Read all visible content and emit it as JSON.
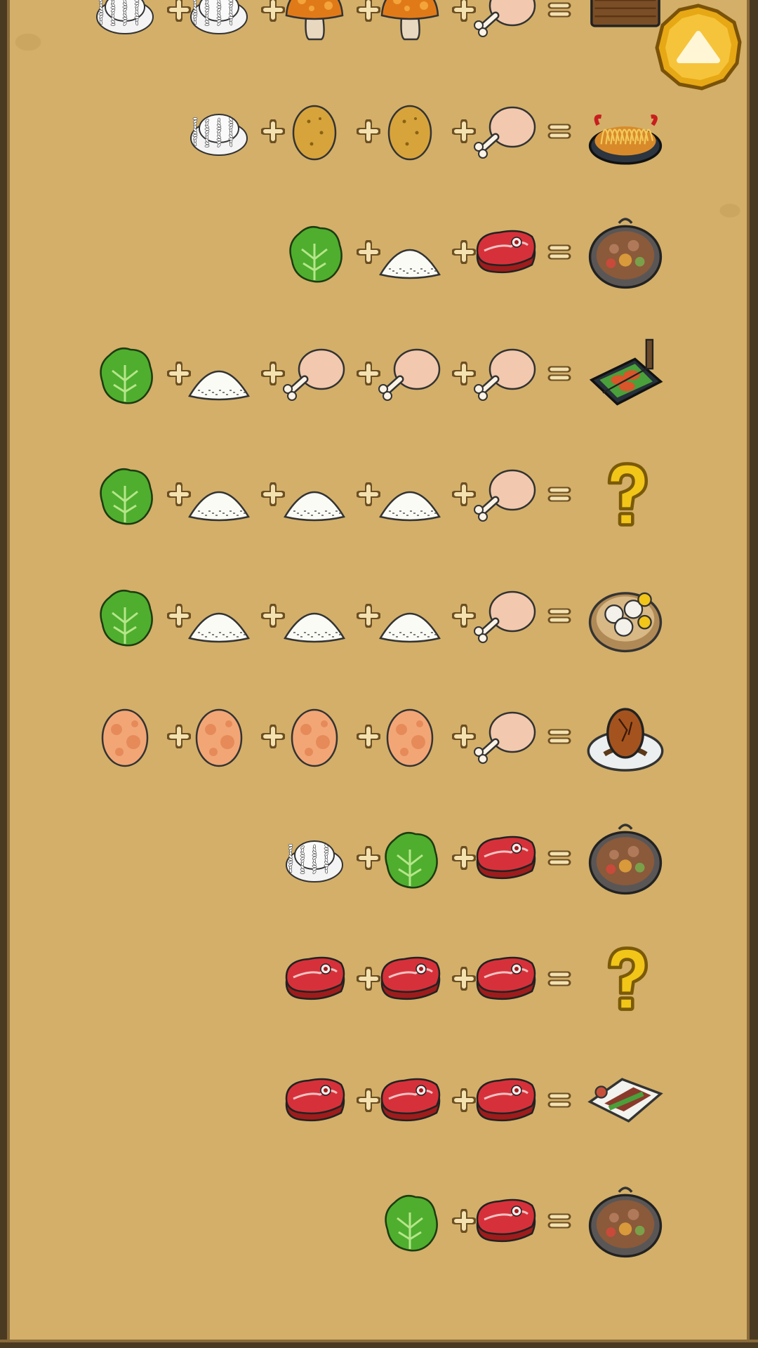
{
  "screen": "recipe-list",
  "colors": {
    "parchment": "#d3af69",
    "frame": "#4b3a22",
    "operator": "#f4e1b0",
    "unknown": "#f0c419"
  },
  "scroll_button": {
    "icon": "arrow-up-icon"
  },
  "recipes": [
    {
      "ingredients": [
        "rice",
        "rice",
        "mushroom",
        "mushroom",
        "drumstick"
      ],
      "result": "rice-ball-platter"
    },
    {
      "ingredients": [
        "rice",
        "potato",
        "potato",
        "drumstick"
      ],
      "result": "spicy-noodles"
    },
    {
      "ingredients": [
        "lettuce",
        "salt",
        "steak"
      ],
      "result": "hotpot"
    },
    {
      "ingredients": [
        "lettuce",
        "salt",
        "drumstick",
        "drumstick",
        "drumstick"
      ],
      "result": "skewer-platter"
    },
    {
      "ingredients": [
        "lettuce",
        "salt",
        "salt",
        "salt",
        "drumstick"
      ],
      "result": "unknown"
    },
    {
      "ingredients": [
        "lettuce",
        "salt",
        "salt",
        "salt",
        "drumstick"
      ],
      "result": "steamed-buns"
    },
    {
      "ingredients": [
        "egg",
        "egg",
        "egg",
        "egg",
        "drumstick"
      ],
      "result": "egg-dish"
    },
    {
      "ingredients": [
        "rice",
        "lettuce",
        "steak"
      ],
      "result": "hotpot"
    },
    {
      "ingredients": [
        "steak",
        "steak",
        "steak"
      ],
      "result": "unknown"
    },
    {
      "ingredients": [
        "steak",
        "steak",
        "steak"
      ],
      "result": "sliced-beef-platter"
    },
    {
      "ingredients": [
        "lettuce",
        "steak"
      ],
      "result": "hotpot"
    }
  ]
}
